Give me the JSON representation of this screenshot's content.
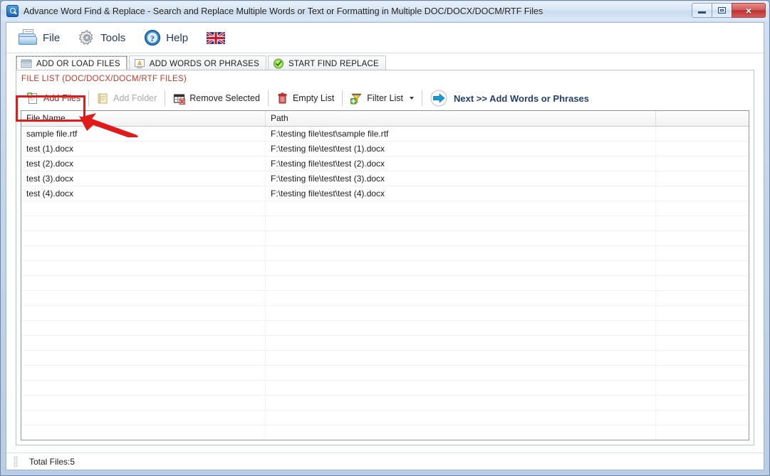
{
  "window": {
    "title": "Advance Word Find & Replace - Search and Replace Multiple Words or Text  or Formatting in Multiple DOC/DOCX/DOCM/RTF Files",
    "app_icon": "magnifier-icon",
    "minimize_label": "Minimize",
    "maximize_label": "Maximize",
    "close_label": "×"
  },
  "menu": {
    "items": [
      {
        "label": "File",
        "icon": "open-folder-icon"
      },
      {
        "label": "Tools",
        "icon": "gear-icon"
      },
      {
        "label": "Help",
        "icon": "question-circle-icon"
      },
      {
        "label": "",
        "icon": "uk-flag-icon"
      }
    ]
  },
  "tabs": [
    {
      "label": "ADD OR LOAD FILES",
      "icon": "folder-open-icon",
      "selected": true
    },
    {
      "label": "ADD WORDS OR PHRASES",
      "icon": "add-word-icon",
      "selected": false
    },
    {
      "label": "START FIND REPLACE",
      "icon": "green-check-icon",
      "selected": false
    }
  ],
  "panel": {
    "title": "FILE LIST (DOC/DOCX/DOCM/RTF FILES)",
    "toolbar": [
      {
        "label": "Add Files",
        "icon": "page-add-icon",
        "state": "highlighted"
      },
      {
        "label": "Add Folder",
        "icon": "folder-add-icon",
        "state": "disabled"
      },
      {
        "label": "Remove Selected",
        "icon": "table-delete-icon",
        "state": "normal"
      },
      {
        "label": "Empty List",
        "icon": "trash-can-icon",
        "state": "normal"
      },
      {
        "label": "Filter List",
        "icon": "funnel-add-icon",
        "state": "normal",
        "has_dropdown": true
      },
      {
        "label": "Next >> Add Words or Phrases",
        "icon": "blue-arrow-right-icon",
        "state": "accent"
      }
    ]
  },
  "grid": {
    "columns": [
      "File Name",
      "Path",
      ""
    ],
    "rows": [
      {
        "name": "sample file.rtf",
        "path": "F:\\testing file\\test\\sample file.rtf",
        "extra": ""
      },
      {
        "name": "test (1).docx",
        "path": "F:\\testing file\\test\\test (1).docx",
        "extra": ""
      },
      {
        "name": "test (2).docx",
        "path": "F:\\testing file\\test\\test (2).docx",
        "extra": ""
      },
      {
        "name": "test (3).docx",
        "path": "F:\\testing file\\test\\test (3).docx",
        "extra": ""
      },
      {
        "name": "test (4).docx",
        "path": "F:\\testing file\\test\\test (4).docx",
        "extra": ""
      }
    ],
    "empty_row_count": 18
  },
  "status": {
    "text": "Total Files:5"
  },
  "annotation": {
    "highlight_color": "#e01b1b",
    "target": "Add Files"
  },
  "colors": {
    "panel_title": "#c0392b",
    "accent_button": "#243f6b",
    "highlight": "#e01b1b"
  }
}
